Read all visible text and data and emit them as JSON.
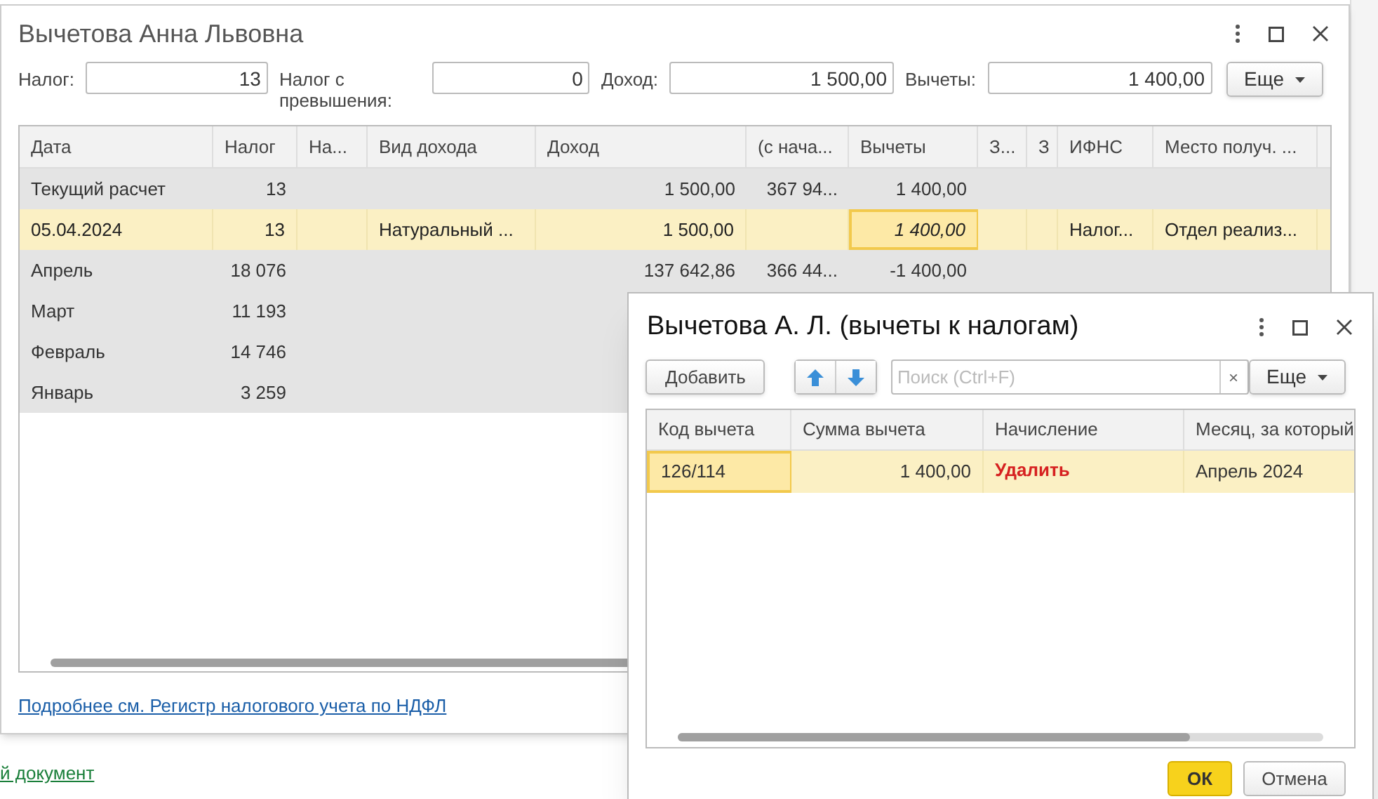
{
  "background": {
    "link": "й документ"
  },
  "window": {
    "title": "Вычетова Анна Львовна",
    "fields": [
      {
        "label": "Налог:",
        "value": "13"
      },
      {
        "label": "Налог с превышения:",
        "value": "0"
      },
      {
        "label": "Доход:",
        "value": "1 500,00"
      },
      {
        "label": "Вычеты:",
        "value": "1 400,00"
      }
    ],
    "more_button": "Еще",
    "table": {
      "columns": [
        "Дата",
        "Налог",
        "На...",
        "Вид дохода",
        "Доход",
        "(с нача...",
        "Вычеты",
        "З...",
        "З",
        "ИФНС",
        "Место получ. ..."
      ],
      "rows": [
        {
          "kind": "group",
          "selected": false,
          "cells": [
            "Текущий расчет",
            "13",
            "",
            "",
            "1 500,00",
            "367 94...",
            "1 400,00",
            "",
            "",
            "",
            ""
          ]
        },
        {
          "kind": "item",
          "selected": true,
          "cells": [
            "05.04.2024",
            "13",
            "",
            "Натуральный ...",
            "1 500,00",
            "",
            {
              "text": "1 400,00",
              "focused": true
            },
            "",
            "",
            "Налог...",
            "Отдел реализ..."
          ]
        },
        {
          "kind": "group",
          "selected": false,
          "cells": [
            "Апрель",
            "18 076",
            "",
            "",
            "137 642,86",
            "366 44...",
            "-1 400,00",
            "",
            "",
            "",
            ""
          ]
        },
        {
          "kind": "group",
          "selected": false,
          "cells": [
            "Март",
            "11 193",
            "",
            "",
            "",
            "",
            "",
            "",
            "",
            "",
            ""
          ]
        },
        {
          "kind": "group",
          "selected": false,
          "cells": [
            "Февраль",
            "14 746",
            "",
            "",
            "",
            "",
            "",
            "",
            "",
            "",
            ""
          ]
        },
        {
          "kind": "group",
          "selected": false,
          "cells": [
            "Январь",
            "3 259",
            "",
            "",
            "",
            "",
            "",
            "",
            "",
            "",
            ""
          ]
        }
      ]
    },
    "link": "Подробнее см. Регистр налогового учета по НДФЛ"
  },
  "dialog": {
    "title": "Вычетова А. Л. (вычеты к налогам)",
    "add_button": "Добавить",
    "search": {
      "placeholder": "Поиск (Ctrl+F)",
      "clear": "×"
    },
    "more_button": "Еще",
    "table": {
      "columns": [
        "Код вычета",
        "Сумма вычета",
        "Начисление",
        "Месяц, за который"
      ],
      "rows": [
        {
          "selected": true,
          "cells": [
            {
              "text": "126/114",
              "focused": true
            },
            "1 400,00",
            {
              "text": "Удалить",
              "kind": "alert"
            },
            "Апрель 2024"
          ]
        }
      ]
    },
    "ok_button": "ОК",
    "cancel_button": "Отмена"
  }
}
